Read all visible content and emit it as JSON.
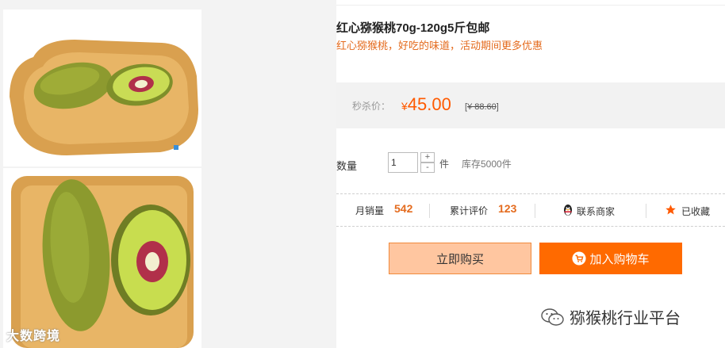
{
  "gallery": {
    "watermark": "大数跨境",
    "images": [
      "red-heart-kiwi-on-tray-photo",
      "red-heart-kiwi-halved-photo"
    ]
  },
  "product": {
    "title": "红心猕猴桃70g-120g5斤包邮",
    "subtitle": "红心猕猴桃，好吃的味道，活动期间更多优惠"
  },
  "price": {
    "label": "秒杀价：",
    "currency": "¥",
    "value": "45.00",
    "old_prefix": "[",
    "old_value": "¥ 88.60",
    "old_suffix": "]"
  },
  "quantity": {
    "label": "数量",
    "value": "1",
    "plus": "+",
    "minus": "-",
    "unit": "件",
    "stock": "库存5000件"
  },
  "stats": {
    "monthly_sales_label": "月销量",
    "monthly_sales_value": "542",
    "reviews_label": "累计评价",
    "reviews_value": "123",
    "contact_label": "联系商家",
    "favorited_label": "已收藏"
  },
  "actions": {
    "buy_now": "立即购买",
    "add_to_cart": "加入购物车"
  },
  "footer": {
    "wechat_account": "猕猴桃行业平台"
  },
  "colors": {
    "accent": "#ff6a00",
    "price": "#ff5a00",
    "subtitle": "#e46b1e"
  }
}
